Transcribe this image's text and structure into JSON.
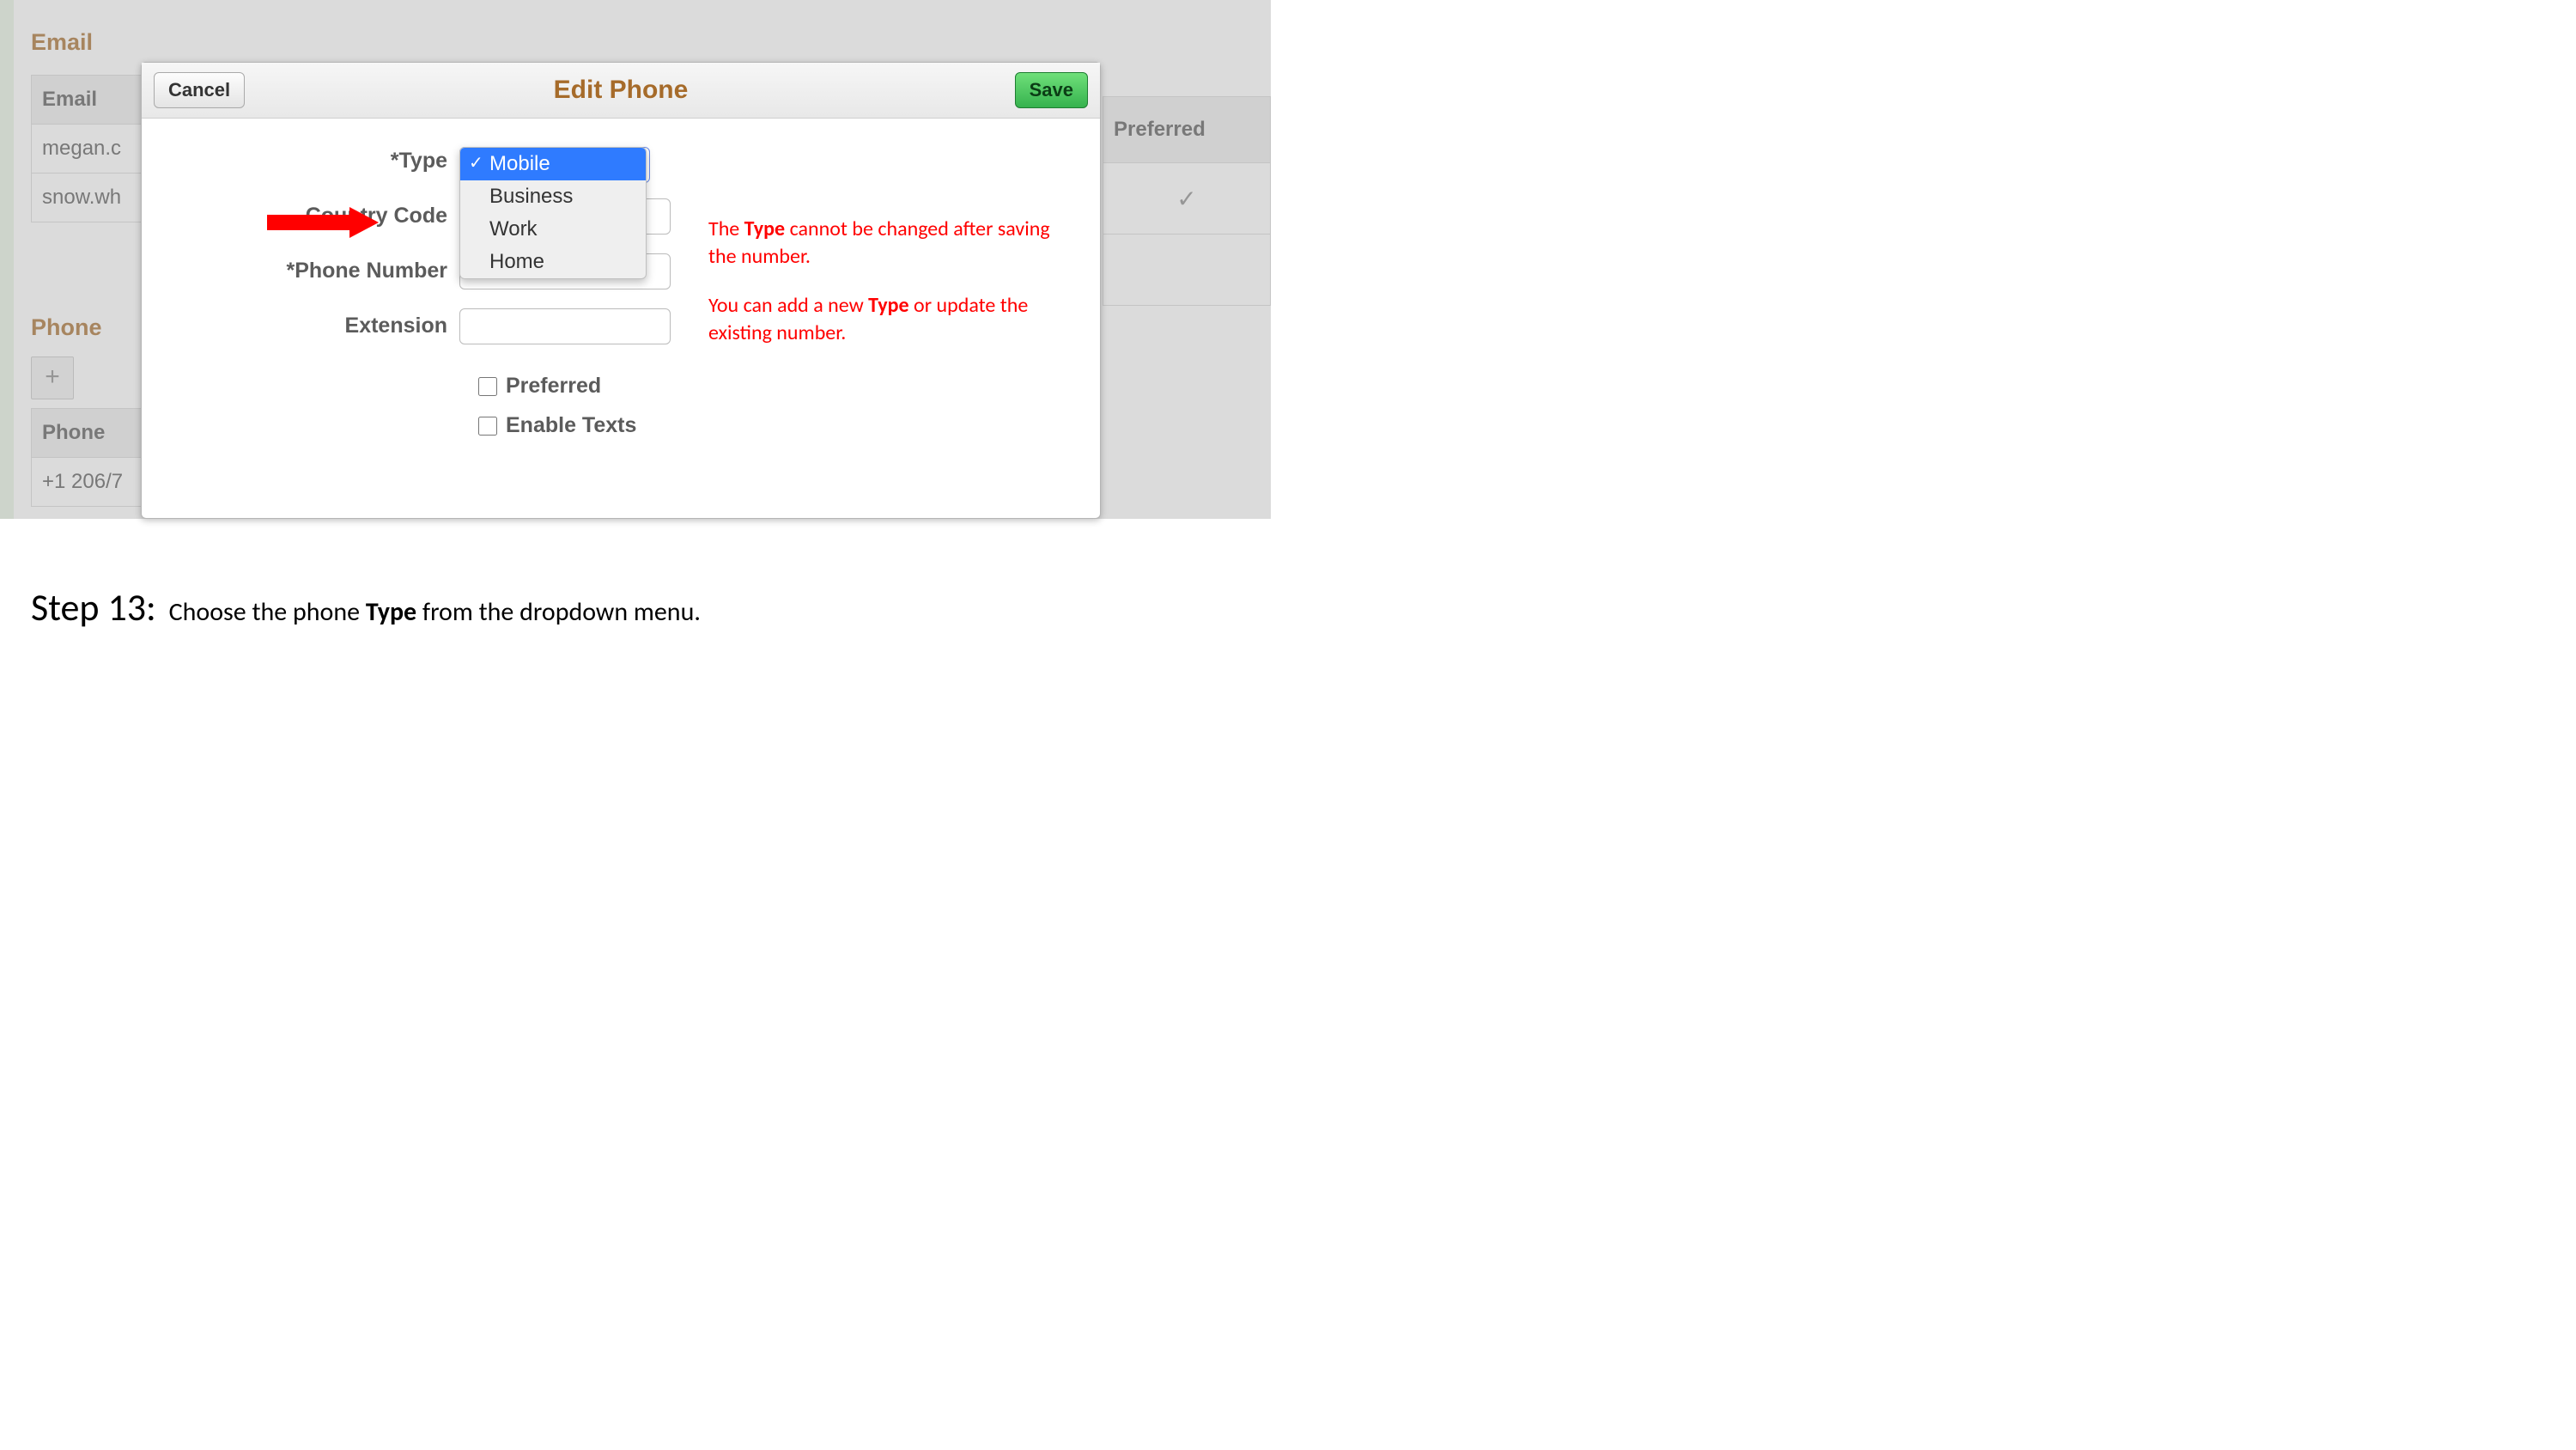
{
  "email_section": {
    "title": "Email",
    "header": "Email",
    "rows": [
      "megan.c",
      "snow.wh"
    ]
  },
  "preferred_header": "Preferred",
  "phone_section": {
    "title": "Phone",
    "header": "Phone",
    "first_row": "+1 206/7"
  },
  "modal": {
    "title": "Edit Phone",
    "cancel": "Cancel",
    "save": "Save",
    "labels": {
      "type": "*Type",
      "country_code": "Country Code",
      "phone_number": "*Phone Number",
      "extension": "Extension",
      "preferred": "Preferred",
      "enable_texts": "Enable Texts"
    },
    "dropdown": {
      "options": [
        "Mobile",
        "Business",
        "Work",
        "Home"
      ],
      "selected": "Mobile"
    }
  },
  "helper": {
    "line1a": "The ",
    "line1b": "Type",
    "line1c": " cannot be changed after saving the number.",
    "line2a": "You can add a new ",
    "line2b": "Type",
    "line2c": " or update the existing number."
  },
  "caption": {
    "step": "Step 13:",
    "text1": " Choose the phone ",
    "bold": "Type",
    "text2": " from the dropdown menu."
  }
}
